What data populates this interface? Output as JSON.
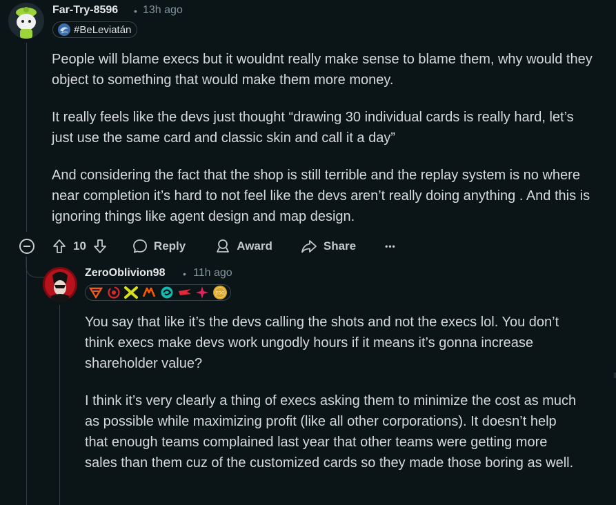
{
  "comment1": {
    "username": "Far-Try-8596",
    "dot": "•",
    "time": "13h ago",
    "flair": "#BeLeviatán",
    "paragraphs": [
      "People will blame execs but it wouldnt really make sense to blame them, why would they object to something that would make them more money.",
      "It really feels like the devs just thought “drawing 30 individual cards is really hard, let’s just use the same card and classic skin and call it a day”",
      "And considering the fact that the shop is still terrible and the replay system is no where near completion it’s hard to not feel like the devs aren’t really doing anything . And this is ignoring things like agent design and map design."
    ],
    "actions": {
      "votes": "10",
      "reply": "Reply",
      "award": "Award",
      "share": "Share",
      "more": "•••"
    }
  },
  "comment2": {
    "username": "ZeroOblivion98",
    "dot": "•",
    "time": "11h ago",
    "badges": [
      "logo",
      "spiral",
      "x-logo",
      "fnatic",
      "blue-swirl",
      "red-claw",
      "pink-star",
      "gold-coin"
    ],
    "badge_coin_text": "EDG",
    "paragraphs": [
      "You say that like it’s the devs calling the shots and not the execs lol. You don’t think execs make devs work ungodly hours if it means it’s gonna increase shareholder value?",
      "I think it’s very clearly a thing of execs asking them to minimize the cost as much as possible while maximizing profit (like all other corporations). It doesn’t help that enough teams complained last year that other teams were getting more sales than them cuz of the customized cards so they made those boring as well."
    ]
  },
  "colors": {
    "background": "#0b1416",
    "text": "#d7dadc",
    "meta": "#82959b",
    "thread_line": "#333d42"
  }
}
